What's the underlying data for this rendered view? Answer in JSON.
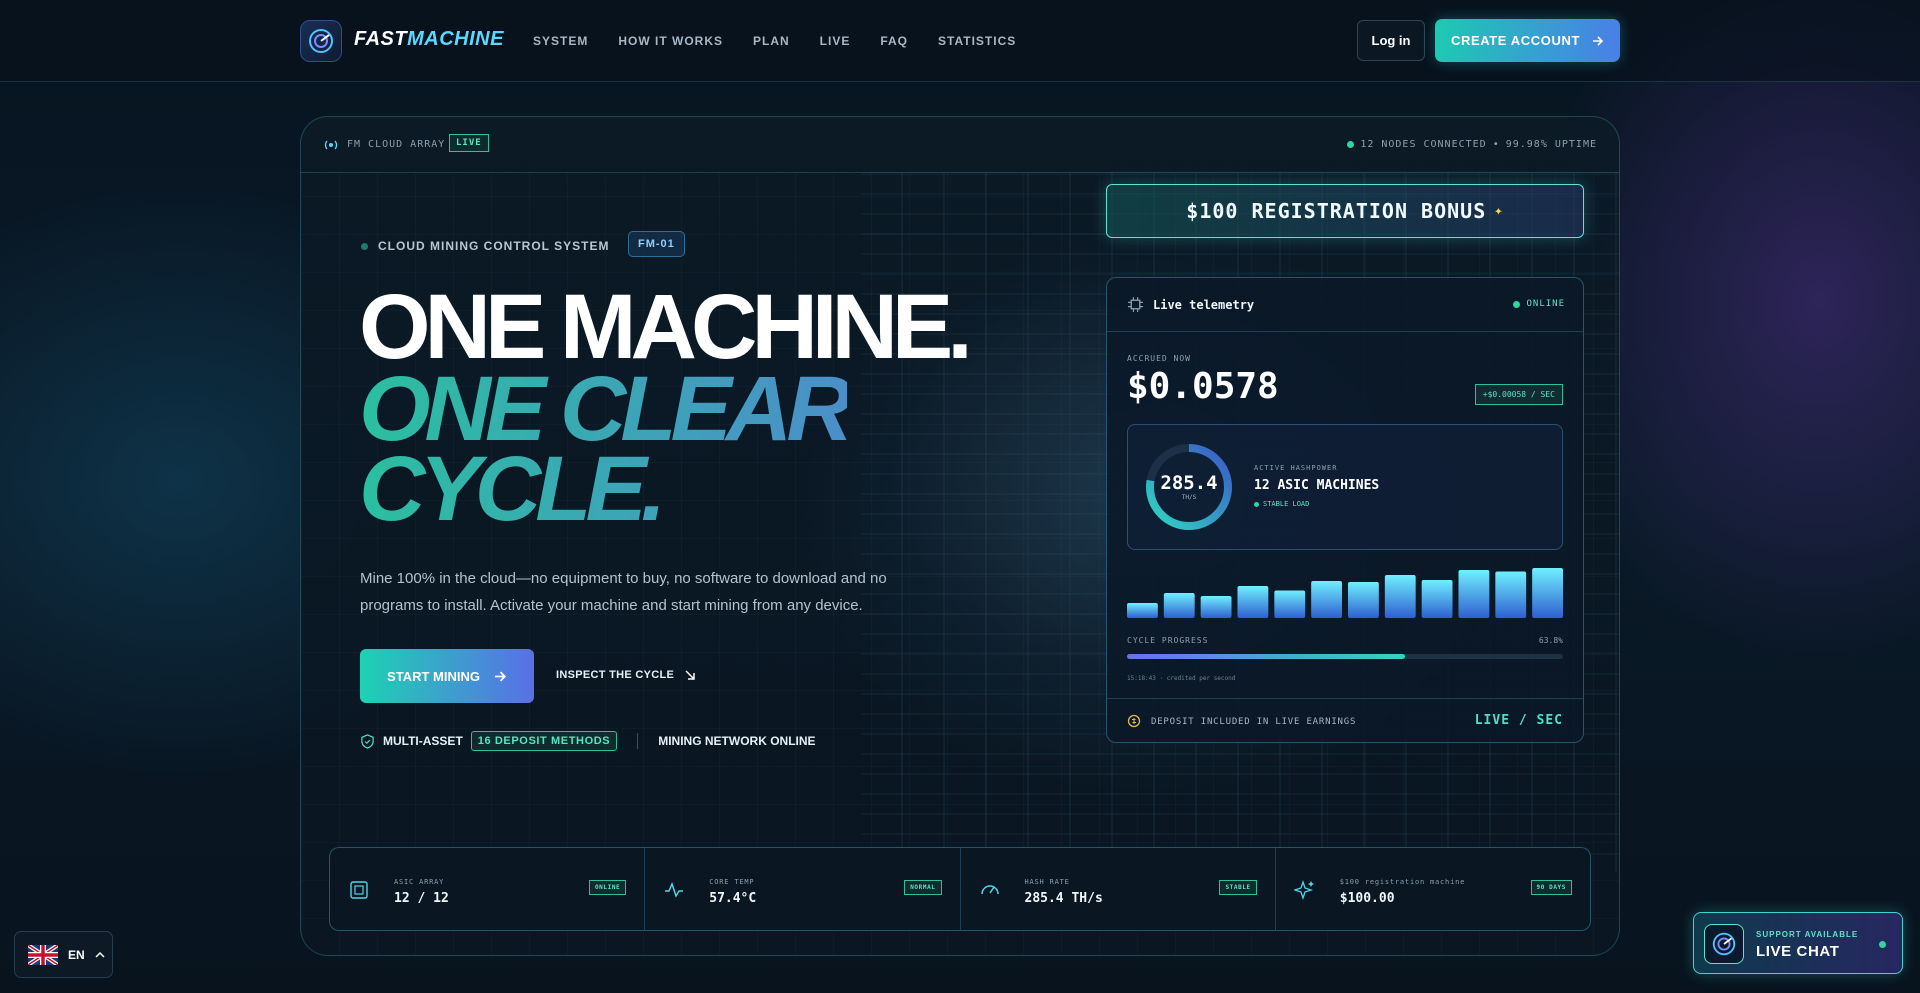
{
  "nav": {
    "brand_a": "FAST",
    "brand_b": "MACHINE",
    "items": [
      "SYSTEM",
      "HOW IT WORKS",
      "PLAN",
      "LIVE",
      "FAQ",
      "STATISTICS"
    ],
    "login": "Log in",
    "create": "CREATE ACCOUNT"
  },
  "panel": {
    "array_label": "FM CLOUD ARRAY",
    "live_tag": "LIVE",
    "nodes": "12 NODES CONNECTED",
    "bullet": "•",
    "uptime": "99.98% UPTIME"
  },
  "hero": {
    "system_label": "CLOUD MINING CONTROL SYSTEM",
    "fm_tag": "FM-01",
    "line1": "ONE MACHINE.",
    "line2": "ONE CLEAR",
    "line3": "CYCLE.",
    "description": "Mine 100% in the cloud—no equipment to buy, no software to download and no programs to install. Activate your machine and start mining from any device.",
    "start": "START MINING",
    "inspect": "INSPECT THE CYCLE",
    "asset": "MULTI-ASSET",
    "deposit": "16 DEPOSIT METHODS",
    "network": "MINING NETWORK ONLINE"
  },
  "bonus": {
    "text": "$100 REGISTRATION BONUS",
    "sparkle": "✦"
  },
  "telemetry": {
    "title": "Live telemetry",
    "status": "ONLINE",
    "accrued_label": "ACCRUED NOW",
    "accrued_value": "$0.0578",
    "rate": "+$0.00058 / SEC",
    "hash_value": "285.4",
    "hash_unit": "TH/S",
    "hash_label": "ACTIVE HASHPOWER",
    "machines": "12 ASIC MACHINES",
    "load": "STABLE LOAD",
    "cycle_label": "CYCLE PROGRESS",
    "cycle_pct": "63.8%",
    "cycle_value": 0.638,
    "credit": "15:18:43 · credited per second",
    "deposit_label": "DEPOSIT INCLUDED IN LIVE EARNINGS",
    "live_sec": "LIVE / SEC",
    "bar_levels": [
      0.3,
      0.5,
      0.44,
      0.64,
      0.55,
      0.74,
      0.72,
      0.86,
      0.76,
      0.96,
      0.93,
      1.0
    ]
  },
  "stats": [
    {
      "icon": "chip-icon",
      "label": "ASIC ARRAY",
      "value": "12 / 12",
      "tag": "ONLINE"
    },
    {
      "icon": "pulse-icon",
      "label": "CORE TEMP",
      "value": "57.4°C",
      "tag": "NORMAL"
    },
    {
      "icon": "gauge-icon",
      "label": "HASH RATE",
      "value": "285.4 TH/s",
      "tag": "STABLE"
    },
    {
      "icon": "sparkle-icon",
      "label": "$100 registration machine",
      "value": "$100.00",
      "tag": "90 DAYS"
    }
  ],
  "language": {
    "code": "EN"
  },
  "chat": {
    "sub": "SUPPORT AVAILABLE",
    "main": "LIVE CHAT"
  },
  "colors": {
    "accent": "#1dc9b2",
    "accent2": "#4a7fe8",
    "online": "#2fd6a0"
  }
}
